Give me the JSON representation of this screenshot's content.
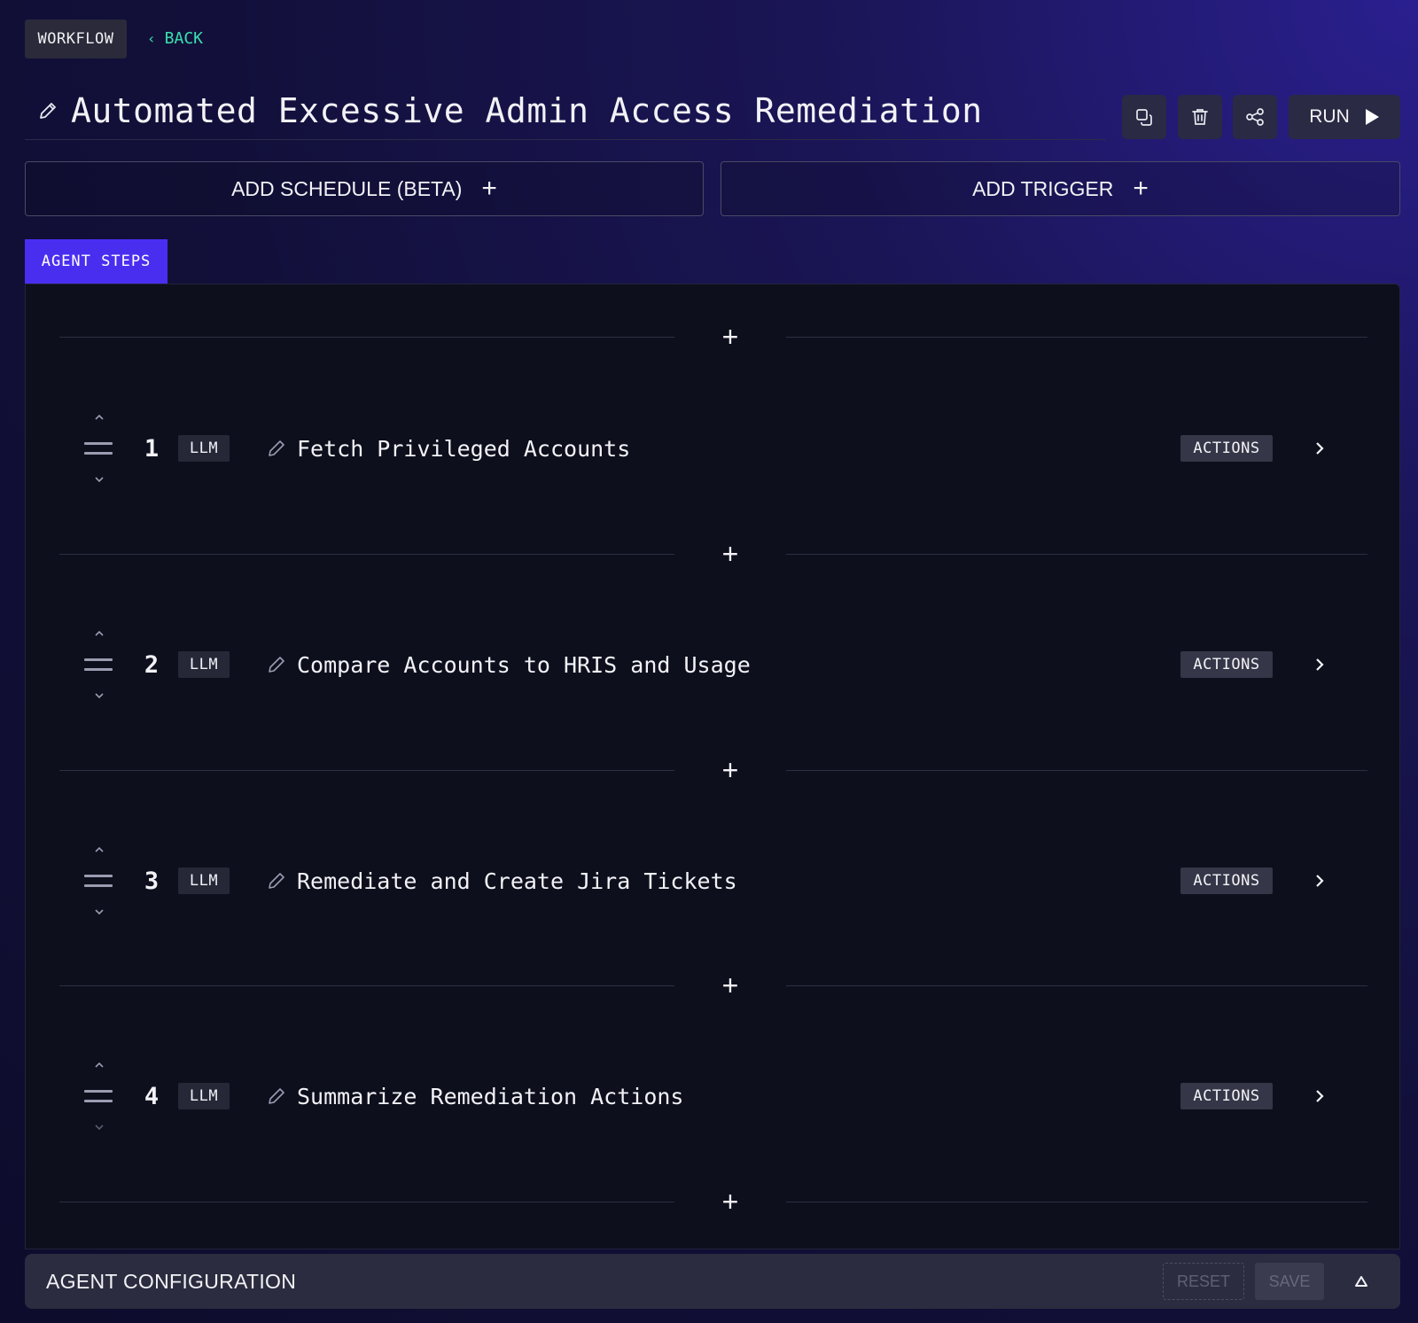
{
  "header": {
    "section_badge": "WORKFLOW",
    "back_label": "BACK",
    "title": "Automated Excessive Admin Access Remediation",
    "run_label": "RUN"
  },
  "toolbar_icons": [
    "duplicate-icon",
    "trash-icon",
    "share-icon",
    "play-icon"
  ],
  "buttons": {
    "add_schedule": "ADD SCHEDULE (BETA)",
    "add_trigger": "ADD TRIGGER"
  },
  "tabs": {
    "agent_steps": "AGENT STEPS"
  },
  "steps": [
    {
      "number": "1",
      "type": "LLM",
      "name": "Fetch Privileged Accounts",
      "actions_label": "ACTIONS"
    },
    {
      "number": "2",
      "type": "LLM",
      "name": "Compare Accounts to HRIS and Usage",
      "actions_label": "ACTIONS"
    },
    {
      "number": "3",
      "type": "LLM",
      "name": "Remediate and Create Jira Tickets",
      "actions_label": "ACTIONS"
    },
    {
      "number": "4",
      "type": "LLM",
      "name": "Summarize Remediation Actions",
      "actions_label": "ACTIONS"
    }
  ],
  "config": {
    "title": "AGENT CONFIGURATION",
    "reset_label": "RESET",
    "save_label": "SAVE"
  },
  "colors": {
    "accent_tab": "#4a2ef0",
    "back_link": "#39e0b0",
    "panel_bg": "#0d0f1d"
  }
}
